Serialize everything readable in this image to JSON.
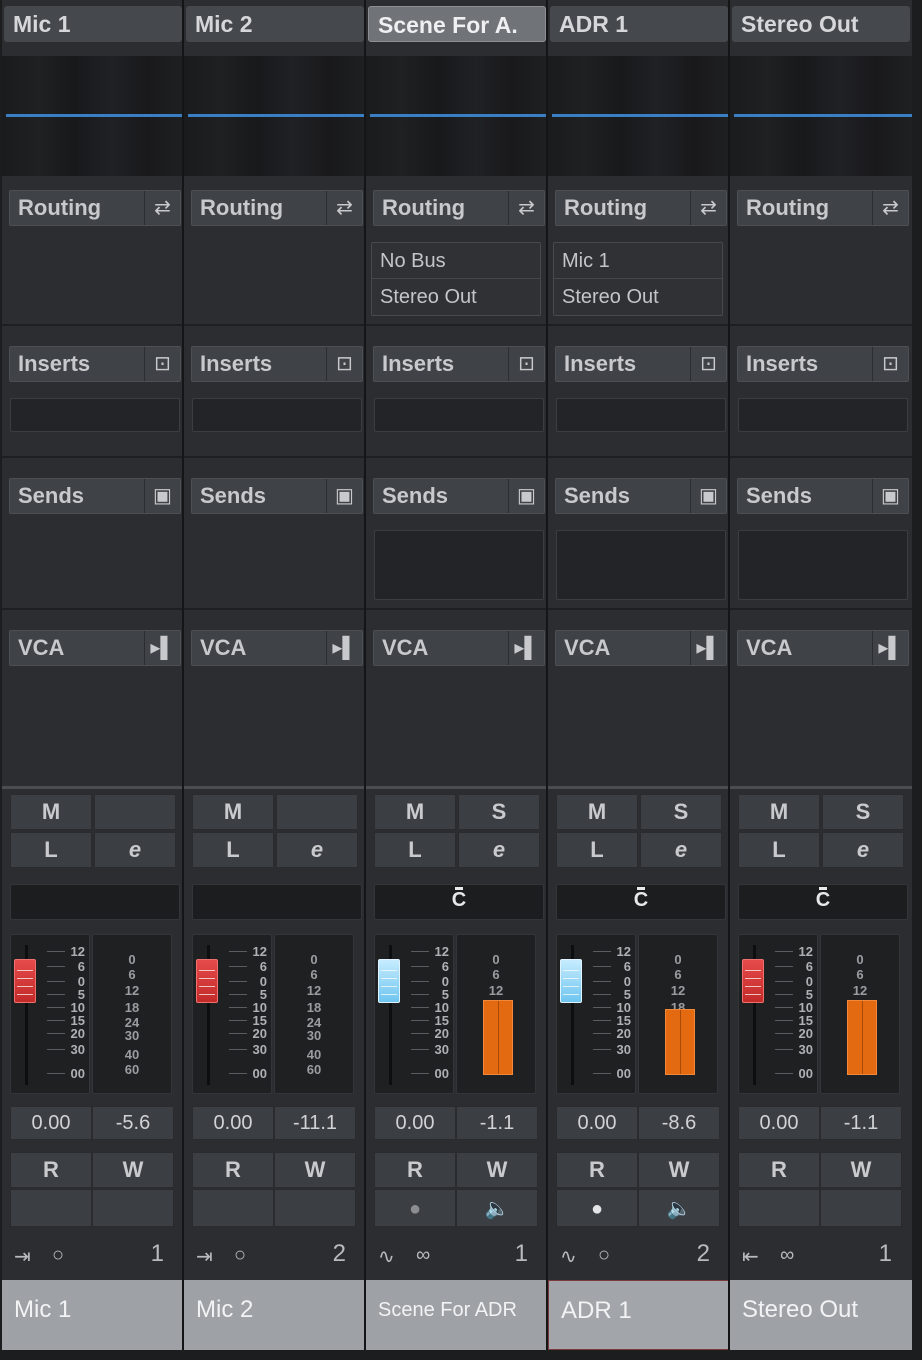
{
  "strips": [
    {
      "title": "Mic 1",
      "routing": "Routing",
      "routes": [],
      "inserts": "Inserts",
      "sends": "Sends",
      "sends_well": false,
      "vca": "VCA",
      "mute": "M",
      "solo": "",
      "listen": "L",
      "edit": "e",
      "pan": "",
      "fader_color": "red",
      "fader_level": "0.00",
      "meter_peak": "-5.6",
      "meter_fill": 0,
      "fader_scale": [
        "12",
        "6",
        "0",
        "5",
        "10",
        "15",
        "20",
        "30",
        "00"
      ],
      "meter_scale": [
        "0",
        "6",
        "12",
        "18",
        "24",
        "30",
        "40",
        "60"
      ],
      "read": "R",
      "write": "W",
      "rec_icon": "",
      "mon_icon": "",
      "input_icon": "input-icon",
      "mode_icon": "mono-icon",
      "number": "1",
      "name": "Mic 1"
    },
    {
      "title": "Mic 2",
      "routing": "Routing",
      "routes": [],
      "inserts": "Inserts",
      "sends": "Sends",
      "sends_well": false,
      "vca": "VCA",
      "mute": "M",
      "solo": "",
      "listen": "L",
      "edit": "e",
      "pan": "",
      "fader_color": "red",
      "fader_level": "0.00",
      "meter_peak": "-11.1",
      "meter_fill": 0,
      "fader_scale": [
        "12",
        "6",
        "0",
        "5",
        "10",
        "15",
        "20",
        "30",
        "00"
      ],
      "meter_scale": [
        "0",
        "6",
        "12",
        "18",
        "24",
        "30",
        "40",
        "60"
      ],
      "read": "R",
      "write": "W",
      "rec_icon": "",
      "mon_icon": "",
      "input_icon": "input-icon",
      "mode_icon": "mono-icon",
      "number": "2",
      "name": "Mic 2"
    },
    {
      "title": "Scene For A.",
      "routing": "Routing",
      "routes": [
        "No Bus",
        "Stereo Out"
      ],
      "inserts": "Inserts",
      "sends": "Sends",
      "sends_well": true,
      "vca": "VCA",
      "mute": "M",
      "solo": "S",
      "listen": "L",
      "edit": "e",
      "pan": "C",
      "fader_color": "blue",
      "fader_level": "0.00",
      "meter_peak": "-1.1",
      "meter_fill": 0.82,
      "fader_scale": [
        "12",
        "6",
        "0",
        "5",
        "10",
        "15",
        "20",
        "30",
        "00"
      ],
      "meter_scale": [
        "0",
        "6",
        "12"
      ],
      "read": "R",
      "write": "W",
      "rec_icon": "●",
      "mon_icon": "🔈",
      "input_icon": "waveform-icon",
      "mode_icon": "stereo-icon",
      "number": "1",
      "name": "Scene For ADR"
    },
    {
      "title": "ADR 1",
      "routing": "Routing",
      "routes": [
        "Mic 1",
        "Stereo Out"
      ],
      "inserts": "Inserts",
      "sends": "Sends",
      "sends_well": true,
      "vca": "VCA",
      "mute": "M",
      "solo": "S",
      "listen": "L",
      "edit": "e",
      "pan": "C",
      "fader_color": "blue",
      "fader_level": "0.00",
      "meter_peak": "-8.6",
      "meter_fill": 0.72,
      "fader_scale": [
        "12",
        "6",
        "0",
        "5",
        "10",
        "15",
        "20",
        "30",
        "00"
      ],
      "meter_scale": [
        "0",
        "6",
        "12",
        "18"
      ],
      "read": "R",
      "write": "W",
      "rec_icon": "●",
      "mon_icon": "🔈",
      "input_icon": "waveform-icon",
      "mode_icon": "mono-icon",
      "number": "2",
      "name": "ADR 1"
    },
    {
      "title": "Stereo Out",
      "routing": "Routing",
      "routes": [],
      "inserts": "Inserts",
      "sends": "Sends",
      "sends_well": true,
      "vca": "VCA",
      "mute": "M",
      "solo": "S",
      "listen": "L",
      "edit": "e",
      "pan": "C",
      "fader_color": "red",
      "fader_level": "0.00",
      "meter_peak": "-1.1",
      "meter_fill": 0.82,
      "fader_scale": [
        "12",
        "6",
        "0",
        "5",
        "10",
        "15",
        "20",
        "30",
        "00"
      ],
      "meter_scale": [
        "0",
        "6",
        "12"
      ],
      "read": "R",
      "write": "W",
      "rec_icon": "",
      "mon_icon": "",
      "input_icon": "output-icon",
      "mode_icon": "stereo-icon",
      "number": "1",
      "name": "Stereo Out"
    }
  ],
  "selected_title_index": 2,
  "selected_name_index": 3,
  "colors": {
    "meter": "#e46a12",
    "fader_red": "#d63a3a",
    "fader_blue": "#8fd6f7",
    "wave_line": "#3a7ec4"
  }
}
